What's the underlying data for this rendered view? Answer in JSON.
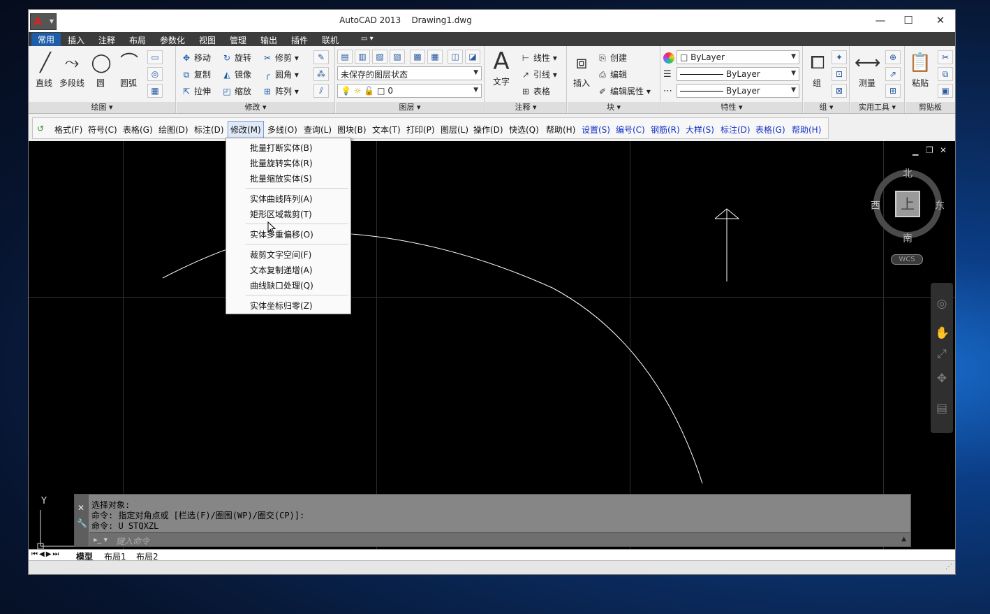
{
  "window": {
    "title": "AutoCAD 2013    Drawing1.dwg",
    "app_logo": "A",
    "controls": {
      "minimize": "—",
      "maximize": "☐",
      "close": "✕"
    },
    "doc_controls": {
      "minimize": "▁",
      "restore": "❐",
      "close": "✕"
    }
  },
  "ribbon_tabs": [
    "常用",
    "插入",
    "注释",
    "布局",
    "参数化",
    "视图",
    "管理",
    "输出",
    "插件",
    "联机"
  ],
  "ribbon": {
    "draw": {
      "line": "直线",
      "polyline": "多段线",
      "circle": "圆",
      "arc": "圆弧",
      "footer": "绘图"
    },
    "modify": {
      "move": "移动",
      "rotate": "旋转",
      "trim": "修剪",
      "copy": "复制",
      "mirror": "镜像",
      "fillet": "圆角",
      "stretch": "拉伸",
      "scale": "缩放",
      "array": "阵列",
      "footer": "修改"
    },
    "layers": {
      "state": "未保存的图层状态",
      "current_layer": "0",
      "footer": "图层"
    },
    "annotation": {
      "text": "文字",
      "linear": "线性",
      "leader": "引线",
      "table": "表格",
      "footer": "注释"
    },
    "block": {
      "insert": "插入",
      "create": "创建",
      "edit": "编辑",
      "edit_attributes": "编辑属性",
      "footer": "块"
    },
    "properties": {
      "color": "ByLayer",
      "linetype": "ByLayer",
      "lineweight": "ByLayer",
      "footer": "特性"
    },
    "groups": {
      "group": "组",
      "footer": "组"
    },
    "utilities": {
      "measure": "测量",
      "footer": "实用工具"
    },
    "clipboard": {
      "paste": "粘贴",
      "footer": "剪贴板"
    }
  },
  "menubar": {
    "items": [
      {
        "label": "格式(F)",
        "blue": false
      },
      {
        "label": "符号(C)",
        "blue": false
      },
      {
        "label": "表格(G)",
        "blue": false
      },
      {
        "label": "绘图(D)",
        "blue": false
      },
      {
        "label": "标注(D)",
        "blue": false
      },
      {
        "label": "修改(M)",
        "blue": false,
        "open": true
      },
      {
        "label": "多线(O)",
        "blue": false
      },
      {
        "label": "查询(L)",
        "blue": false
      },
      {
        "label": "图块(B)",
        "blue": false
      },
      {
        "label": "文本(T)",
        "blue": false
      },
      {
        "label": "打印(P)",
        "blue": false
      },
      {
        "label": "图层(L)",
        "blue": false
      },
      {
        "label": "操作(D)",
        "blue": false
      },
      {
        "label": "快选(Q)",
        "blue": false
      },
      {
        "label": "帮助(H)",
        "blue": false
      },
      {
        "label": "设置(S)",
        "blue": true
      },
      {
        "label": "编号(C)",
        "blue": true
      },
      {
        "label": "钢筋(R)",
        "blue": true
      },
      {
        "label": "大样(S)",
        "blue": true
      },
      {
        "label": "标注(D)",
        "blue": true
      },
      {
        "label": "表格(G)",
        "blue": true
      },
      {
        "label": "帮助(H)",
        "blue": true
      }
    ]
  },
  "dropdown": {
    "groups": [
      [
        "批量打断实体(B)",
        "批量旋转实体(R)",
        "批量缩放实体(S)"
      ],
      [
        "实体曲线阵列(A)",
        "矩形区域裁剪(T)"
      ],
      [
        "实体多重偏移(O)"
      ],
      [
        "裁剪文字空间(F)",
        "文本复制递增(A)",
        "曲线缺口处理(Q)"
      ],
      [
        "实体坐标归零(Z)"
      ]
    ]
  },
  "viewcube": {
    "north": "北",
    "south": "南",
    "east": "东",
    "west": "西",
    "top": "上",
    "wcs": "WCS"
  },
  "ucs": {
    "y_label": "Y"
  },
  "command": {
    "lines": [
      "选择对象:",
      "命令: 指定对角点或 [栏选(F)/圈围(WP)/圈交(CP)]:",
      "命令: U STQXZL"
    ],
    "placeholder": "键入命令"
  },
  "layout_tabs": [
    "模型",
    "布局1",
    "布局2"
  ]
}
